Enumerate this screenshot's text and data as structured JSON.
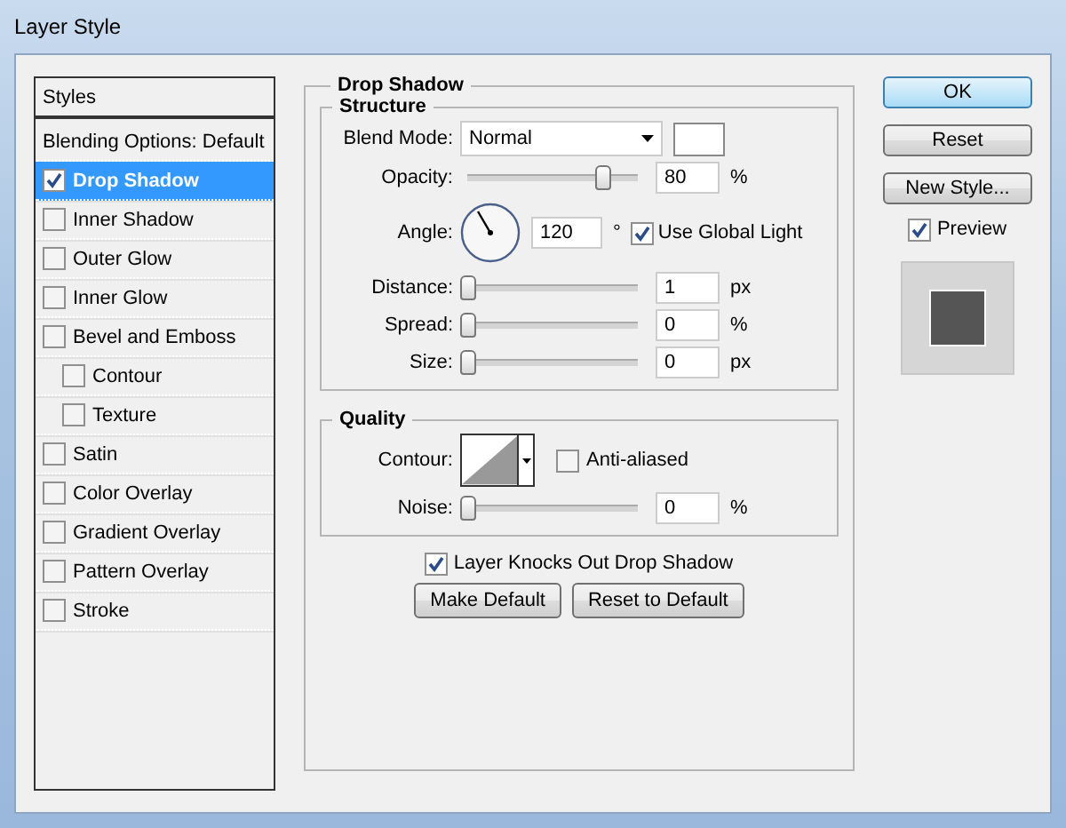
{
  "window": {
    "title": "Layer Style"
  },
  "styles_panel": {
    "header": "Styles",
    "items": [
      {
        "label": "Blending Options: Default",
        "kind": "plain",
        "selected": false
      },
      {
        "label": "Drop Shadow",
        "kind": "check",
        "checked": true,
        "selected": true
      },
      {
        "label": "Inner Shadow",
        "kind": "check",
        "checked": false,
        "selected": false
      },
      {
        "label": "Outer Glow",
        "kind": "check",
        "checked": false,
        "selected": false
      },
      {
        "label": "Inner Glow",
        "kind": "check",
        "checked": false,
        "selected": false
      },
      {
        "label": "Bevel and Emboss",
        "kind": "check",
        "checked": false,
        "selected": false,
        "children": [
          {
            "label": "Contour",
            "kind": "check",
            "checked": false,
            "selected": false
          },
          {
            "label": "Texture",
            "kind": "check",
            "checked": false,
            "selected": false
          }
        ]
      },
      {
        "label": "Satin",
        "kind": "check",
        "checked": false,
        "selected": false
      },
      {
        "label": "Color Overlay",
        "kind": "check",
        "checked": false,
        "selected": false
      },
      {
        "label": "Gradient Overlay",
        "kind": "check",
        "checked": false,
        "selected": false
      },
      {
        "label": "Pattern Overlay",
        "kind": "check",
        "checked": false,
        "selected": false
      },
      {
        "label": "Stroke",
        "kind": "check",
        "checked": false,
        "selected": false
      }
    ]
  },
  "drop_shadow": {
    "title": "Drop Shadow",
    "structure": {
      "title": "Structure",
      "blend_mode": {
        "label": "Blend Mode:",
        "value": "Normal"
      },
      "opacity": {
        "label": "Opacity:",
        "level": 0.8,
        "value": "80",
        "unit": "%"
      },
      "angle": {
        "label": "Angle:",
        "value": "120",
        "unit": "°"
      },
      "use_global_light": {
        "label": "Use Global Light",
        "checked": true
      },
      "sliders": [
        {
          "label": "Distance:",
          "level": 0,
          "value": "1",
          "unit": "px"
        },
        {
          "label": "Spread:",
          "level": 0,
          "value": "0",
          "unit": "%"
        },
        {
          "label": "Size:",
          "level": 0,
          "value": "0",
          "unit": "px"
        }
      ]
    },
    "quality": {
      "title": "Quality",
      "contour": {
        "label": "Contour:"
      },
      "anti_aliased": {
        "label": "Anti-aliased",
        "checked": false
      },
      "noise": {
        "label": "Noise:",
        "level": 0,
        "value": "0",
        "unit": "%"
      }
    },
    "knockout": {
      "label": "Layer Knocks Out Drop Shadow",
      "checked": true
    },
    "buttons": [
      "Make Default",
      "Reset to Default"
    ]
  },
  "actions": [
    {
      "label": "OK",
      "default": true
    },
    {
      "label": "Reset",
      "default": false
    },
    {
      "label": "New Style...",
      "default": false
    }
  ],
  "preview": {
    "label": "Preview",
    "checked": true
  }
}
